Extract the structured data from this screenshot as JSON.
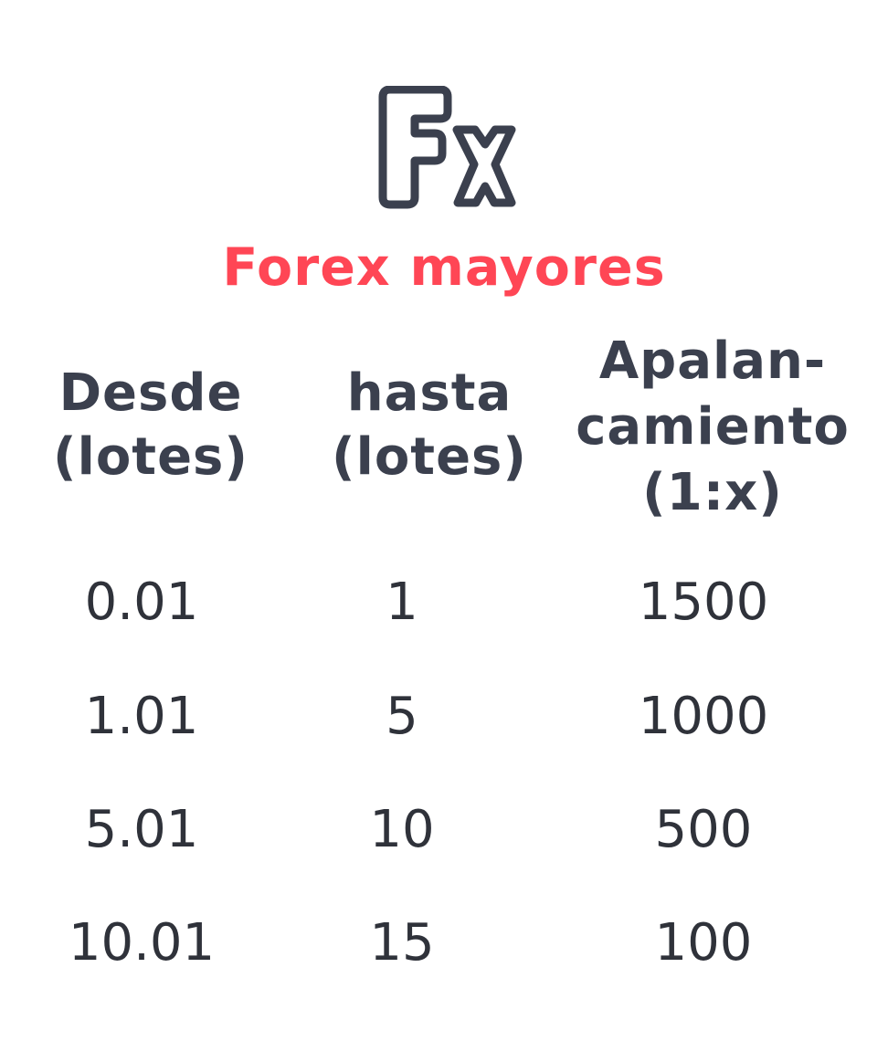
{
  "logo": {
    "icon": "fx-icon",
    "color": "#3b404e"
  },
  "title": "Forex mayores",
  "colors": {
    "accent": "#ff4655",
    "heading": "#3b404e",
    "text": "#2f323a"
  },
  "table": {
    "headers": [
      [
        "Desde",
        "(lotes)"
      ],
      [
        "hasta",
        "(lotes)"
      ],
      [
        "Apalan-",
        "camiento",
        "(1:x)"
      ]
    ],
    "rows": [
      [
        "0.01",
        "1",
        "1500"
      ],
      [
        "1.01",
        "5",
        "1000"
      ],
      [
        "5.01",
        "10",
        "500"
      ],
      [
        "10.01",
        "15",
        "100"
      ]
    ]
  }
}
